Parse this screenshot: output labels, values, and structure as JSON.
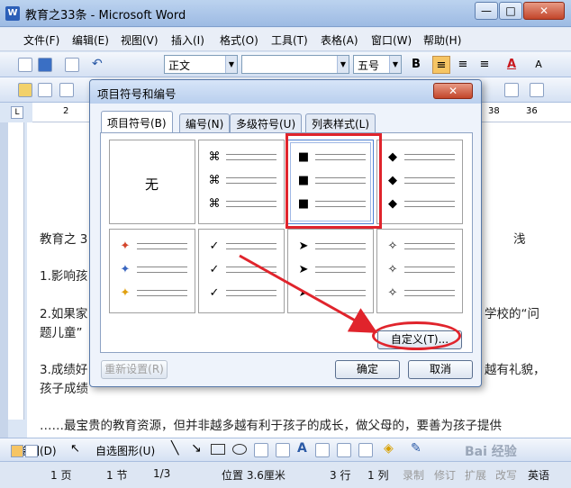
{
  "window": {
    "title": "教育之33条 - Microsoft Word",
    "app_icon": "W",
    "min_glyph": "—",
    "max_glyph": "□",
    "close_glyph": "✕"
  },
  "menu": [
    "文件(F)",
    "编辑(E)",
    "视图(V)",
    "插入(I)",
    "格式(O)",
    "工具(T)",
    "表格(A)",
    "窗口(W)",
    "帮助(H)"
  ],
  "toolbar": {
    "style_value": "正文",
    "size_value": "五号",
    "bold": "B",
    "font_color_glyph": "A",
    "font_size_glyph": "A"
  },
  "ruler": {
    "ticks": [
      "2",
      "38",
      "36",
      "3"
    ]
  },
  "document": {
    "lines": [
      "教育之 3",
      "浅",
      "1.影响孩",
      "2.如果家",
      "学校的“问",
      "题儿童”",
      "3.成绩好",
      "越有礼貌，",
      "孩子成绩",
      "……最宝贵的教育资源，但并非越多越有利于孩子的成长，做父母的，要善为孩子提供"
    ]
  },
  "dialog": {
    "title": "项目符号和编号",
    "close_glyph": "✕",
    "tabs": [
      "项目符号(B)",
      "编号(N)",
      "多级符号(U)",
      "列表样式(L)"
    ],
    "none_label": "无",
    "bullets": [
      "⌘",
      "■",
      "◆",
      "✦",
      "✓",
      "➤",
      "✧"
    ],
    "customize_label": "自定义(T)...",
    "reset_label": "重新设置(R)",
    "ok_label": "确定",
    "cancel_label": "取消"
  },
  "drawbar": {
    "draw_label": "绘图(D)",
    "autoshapes_label": "自选图形(U)",
    "watermark": "Bai 经验"
  },
  "status": {
    "page": "1 页",
    "section": "1 节",
    "pages": "1/3",
    "position": "位置 3.6厘米",
    "line": "3 行",
    "column": "1 列",
    "rec": "录制",
    "trk": "修订",
    "ext": "扩展",
    "ovr": "改写",
    "lang": "英语"
  },
  "colors": {
    "accent": "#e0242c",
    "dialog_bg": "#eef3fb"
  }
}
